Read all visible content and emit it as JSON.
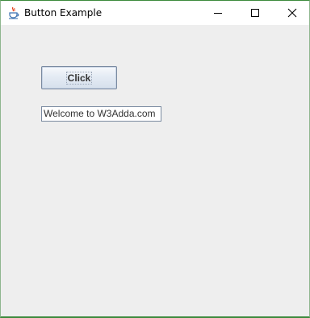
{
  "window": {
    "title": "Button Example",
    "app_icon": "java-cup-icon",
    "controls": {
      "minimize_icon": "minimize-icon",
      "maximize_icon": "maximize-icon",
      "close_icon": "close-icon"
    }
  },
  "content": {
    "button_label": "Click",
    "text_field_value": "Welcome to W3Adda.com"
  },
  "colors": {
    "content_background": "#eeeeee",
    "window_border": "#3c8a3c",
    "button_border": "#7a8aa0"
  }
}
